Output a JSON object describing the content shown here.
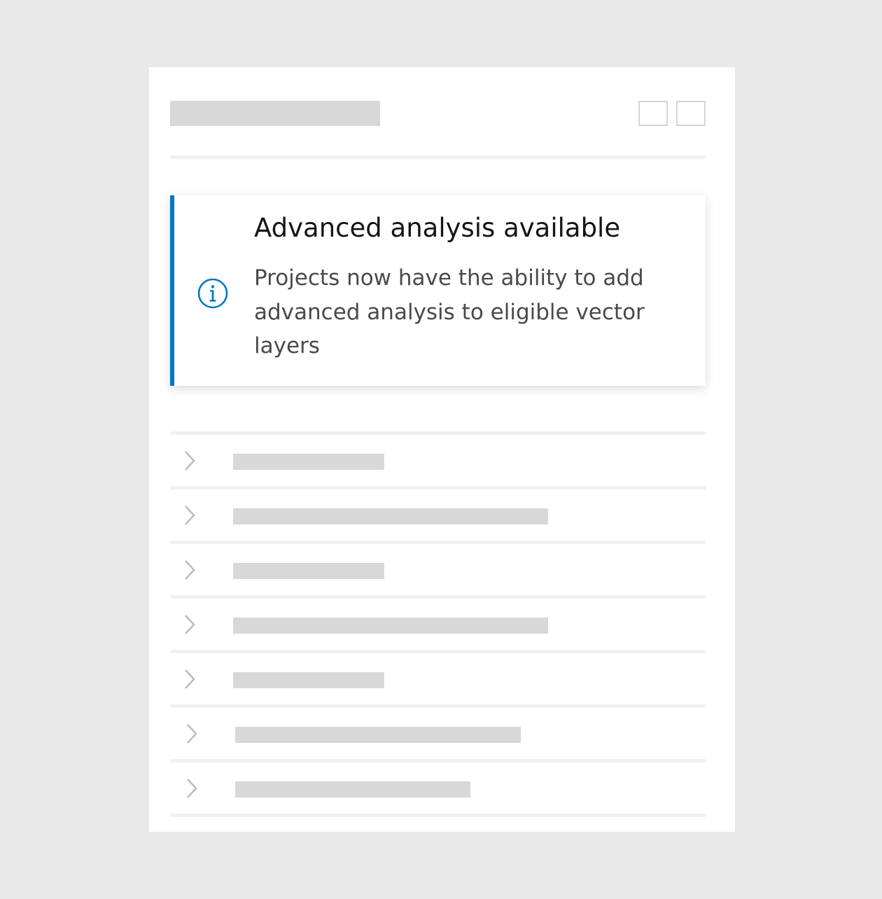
{
  "notice": {
    "title": "Advanced analysis available",
    "message": "Projects now have the ability to add advanced analysis to eligible vector layers",
    "icon": "info-icon",
    "accent_color": "#0079c1"
  },
  "header": {
    "actions": [
      "action-button-1",
      "action-button-2"
    ]
  },
  "list": {
    "item_count": 7,
    "expand_icon": "chevron-right-icon"
  },
  "colors": {
    "background": "#e9e9e9",
    "panel": "#ffffff",
    "placeholder": "#d8d8d8",
    "divider": "#f1f1f1",
    "accent": "#0079c1"
  }
}
